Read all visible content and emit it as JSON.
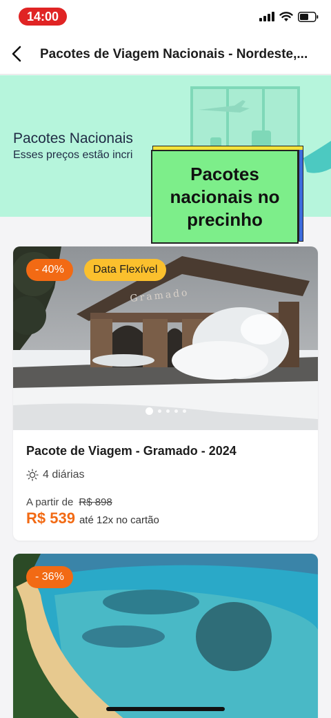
{
  "status_bar": {
    "time": "14:00"
  },
  "header": {
    "title": "Pacotes de Viagem Nacionais - Nordeste,..."
  },
  "banner": {
    "title": "Pacotes Nacionais",
    "subtitle": "Esses preços estão incri",
    "sticker_text": "Pacotes nacionais no precinho"
  },
  "cards": [
    {
      "badges": [
        "- 40%",
        "Data Flexível"
      ],
      "image_sign_text": "Gramado",
      "title": "Pacote de Viagem - Gramado - 2024",
      "duration": "4 diárias",
      "price_label": "A partir de",
      "old_price": "R$ 898",
      "price": "R$ 539",
      "installments": "até 12x no cartão"
    },
    {
      "badges": [
        "- 36%"
      ]
    }
  ],
  "colors": {
    "accent": "#f26a14",
    "flex_badge": "#fbc02d",
    "banner_bg": "#b6f5dc",
    "sticker": "#7dee8a",
    "time_pill": "#e02424"
  }
}
